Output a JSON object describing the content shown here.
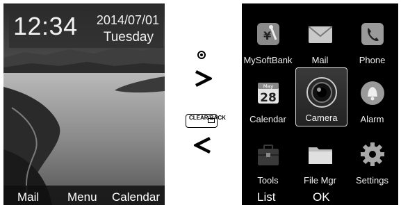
{
  "standby": {
    "time": "12:34",
    "date": "2014/07/01",
    "day": "Tuesday",
    "softkeys": {
      "left": "Mail",
      "center": "Menu",
      "right": "Calendar"
    }
  },
  "legend": {
    "next_key_icon": "center-select-key-icon",
    "next_symbol": ">",
    "back_key_label": "CLEAR/BACK",
    "back_key_icon": "clear-back-key-icon",
    "back_symbol": "<"
  },
  "menu": {
    "items": [
      {
        "label": "MySoftBank",
        "icon": "mysoftbank-icon"
      },
      {
        "label": "Mail",
        "icon": "mail-icon"
      },
      {
        "label": "Phone",
        "icon": "phone-icon"
      },
      {
        "label": "Calendar",
        "icon": "calendar-icon",
        "icon_text_month": "May",
        "icon_text_day": "28"
      },
      {
        "label": "Camera",
        "icon": "camera-icon",
        "selected": true
      },
      {
        "label": "Alarm",
        "icon": "alarm-bell-icon"
      },
      {
        "label": "Tools",
        "icon": "tools-icon"
      },
      {
        "label": "File Mgr",
        "icon": "folder-icon"
      },
      {
        "label": "Settings",
        "icon": "gear-icon"
      }
    ],
    "softkeys": {
      "left": "List",
      "center": "OK"
    }
  },
  "colors": {
    "menu_background": "#000000",
    "selection_border": "#d8d8d8",
    "clock_panel": "#2d2d2d"
  }
}
